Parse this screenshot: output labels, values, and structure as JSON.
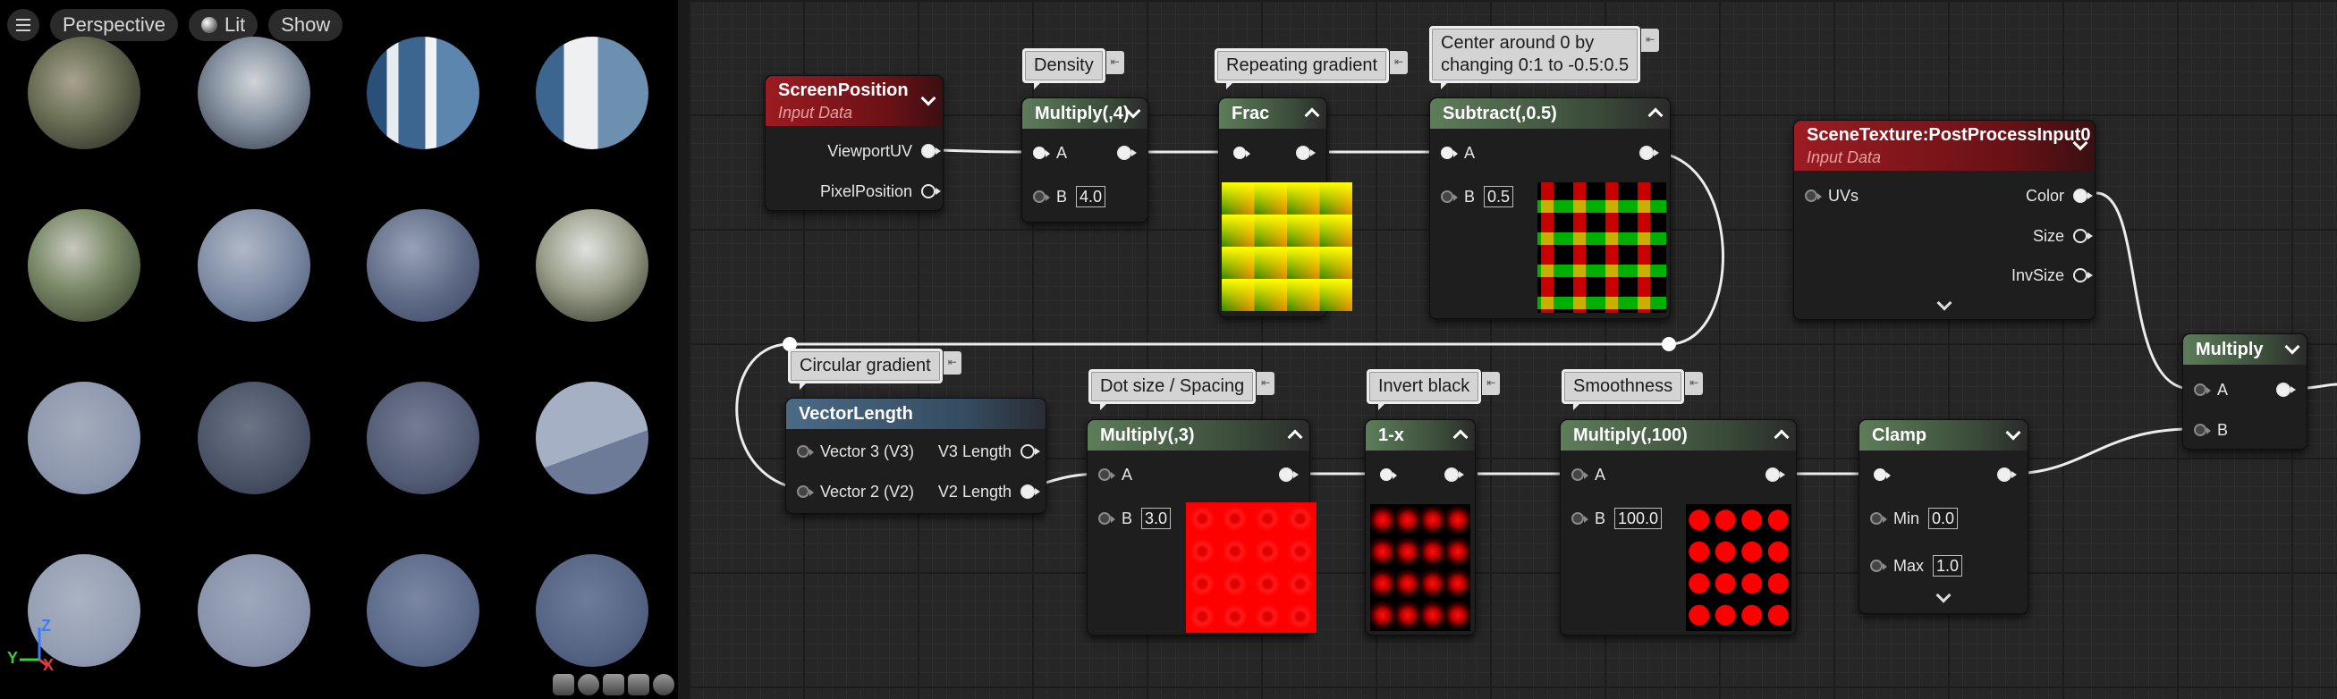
{
  "viewport": {
    "perspective_label": "Perspective",
    "lit_label": "Lit",
    "show_label": "Show",
    "axis": {
      "z": "Z",
      "y": "Y",
      "x": "X"
    }
  },
  "comments": {
    "density": "Density",
    "repeating": "Repeating gradient",
    "center": "Center around 0 by\nchanging 0:1 to -0.5:0.5",
    "circular": "Circular gradient",
    "dotsize": "Dot size / Spacing",
    "invert": "Invert black",
    "smoothness": "Smoothness"
  },
  "nodes": {
    "screenpos": {
      "title": "ScreenPosition",
      "subtitle": "Input Data",
      "out1": "ViewportUV",
      "out2": "PixelPosition"
    },
    "mul4": {
      "title": "Multiply(,4)",
      "a": "A",
      "b": "B",
      "b_val": "4.0"
    },
    "frac": {
      "title": "Frac"
    },
    "sub": {
      "title": "Subtract(,0.5)",
      "a": "A",
      "b": "B",
      "b_val": "0.5"
    },
    "scenetex": {
      "title": "SceneTexture:PostProcessInput0",
      "subtitle": "Input Data",
      "in1": "UVs",
      "out1": "Color",
      "out2": "Size",
      "out3": "InvSize"
    },
    "veclen": {
      "title": "VectorLength",
      "in1": "Vector 3 (V3)",
      "out1": "V3 Length",
      "in2": "Vector 2 (V2)",
      "out2": "V2 Length"
    },
    "mul3": {
      "title": "Multiply(,3)",
      "a": "A",
      "b": "B",
      "b_val": "3.0"
    },
    "inv": {
      "title": "1-x"
    },
    "mul100": {
      "title": "Multiply(,100)",
      "a": "A",
      "b": "B",
      "b_val": "100.0"
    },
    "clamp": {
      "title": "Clamp",
      "min": "Min",
      "min_val": "0.0",
      "max": "Max",
      "max_val": "1.0"
    },
    "multiply": {
      "title": "Multiply",
      "a": "A",
      "b": "B"
    }
  },
  "colors": {
    "input_red": "#9b1c22",
    "math_green": "#5d7d5a",
    "vector_blue": "#4a6a86"
  }
}
